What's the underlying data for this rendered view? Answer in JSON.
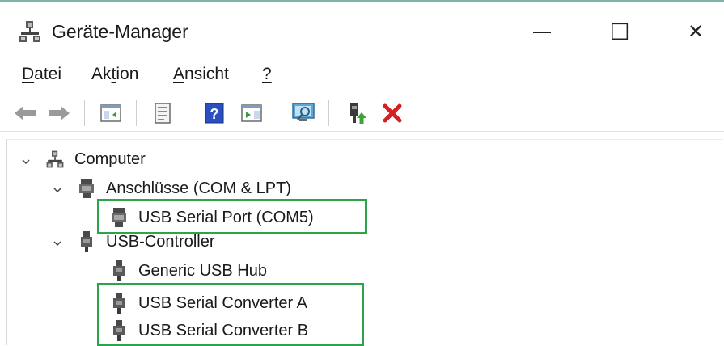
{
  "window": {
    "title": "Geräte-Manager",
    "minimize_glyph": "—",
    "maximize_glyph": "☐",
    "close_glyph": "✕"
  },
  "menu": [
    {
      "mnemonic": "D",
      "rest": "atei"
    },
    {
      "pre": "Ak",
      "mnemonic": "t",
      "rest": "ion"
    },
    {
      "mnemonic": "A",
      "rest": "nsicht"
    },
    {
      "mnemonic": "?",
      "rest": ""
    }
  ],
  "toolbar": {
    "icons": [
      "back-arrow-icon",
      "forward-arrow-icon",
      "console-tree-icon",
      "properties-icon",
      "help-icon",
      "action-pane-icon",
      "scan-hardware-icon",
      "update-driver-icon",
      "uninstall-icon"
    ]
  },
  "tree": {
    "root": {
      "label": "Computer",
      "icon": "computer-icon",
      "expanded": true
    },
    "groups": [
      {
        "label": "Anschlüsse (COM & LPT)",
        "icon": "port-icon",
        "expanded": true,
        "children": [
          {
            "label": "USB Serial Port (COM5)",
            "icon": "port-icon",
            "highlighted": true
          }
        ]
      },
      {
        "label": "USB-Controller",
        "icon": "usb-plug-icon",
        "expanded": true,
        "children": [
          {
            "label": "Generic USB Hub",
            "icon": "usb-plug-icon",
            "highlighted": false
          },
          {
            "label": "USB Serial Converter A",
            "icon": "usb-plug-icon",
            "highlighted": true
          },
          {
            "label": "USB Serial Converter B",
            "icon": "usb-plug-icon",
            "highlighted": true
          }
        ]
      }
    ]
  },
  "colors": {
    "highlight_border": "#2ca44a",
    "uninstall_red": "#d81e1e",
    "help_blue": "#2a4fc0"
  }
}
